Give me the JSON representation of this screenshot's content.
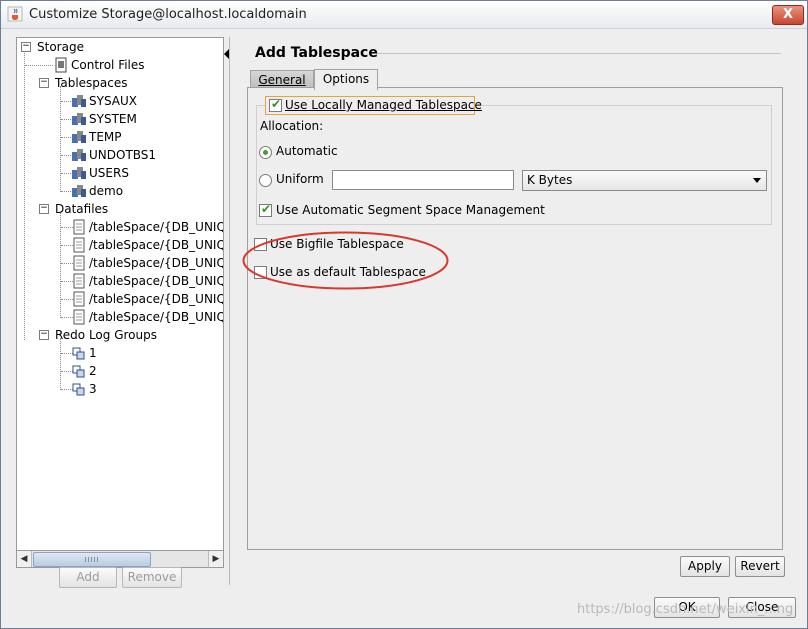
{
  "window": {
    "title": "Customize Storage@localhost.localdomain",
    "close_glyph": "X"
  },
  "tree": {
    "root": "Storage",
    "control_files": "Control Files",
    "tablespaces_label": "Tablespaces",
    "tablespaces": [
      "SYSAUX",
      "SYSTEM",
      "TEMP",
      "UNDOTBS1",
      "USERS",
      "demo"
    ],
    "datafiles_label": "Datafiles",
    "datafiles": [
      "/tableSpace/{DB_UNIQU",
      "/tableSpace/{DB_UNIQU",
      "/tableSpace/{DB_UNIQU",
      "/tableSpace/{DB_UNIQU",
      "/tableSpace/{DB_UNIQU",
      "/tableSpace/{DB_UNIQU"
    ],
    "redo_label": "Redo Log Groups",
    "redo_groups": [
      "1",
      "2",
      "3"
    ]
  },
  "tree_buttons": {
    "add": "Add",
    "remove": "Remove"
  },
  "panel": {
    "heading": "Add Tablespace",
    "tabs": [
      {
        "label": "General",
        "selected": false
      },
      {
        "label": "Options",
        "selected": true
      }
    ],
    "use_locally_managed": {
      "label": "Use Locally Managed Tablespace",
      "checked": true
    },
    "allocation_label": "Allocation:",
    "automatic": {
      "label": "Automatic",
      "selected": true
    },
    "uniform": {
      "label": "Uniform",
      "selected": false,
      "value": ""
    },
    "unit_select": {
      "value": "K Bytes"
    },
    "auto_segment": {
      "label": "Use Automatic Segment Space Management",
      "checked": true
    },
    "bigfile": {
      "label": "Use Bigfile Tablespace",
      "checked": false
    },
    "default_ts": {
      "label": "Use as default Tablespace",
      "checked": false
    }
  },
  "footer": {
    "apply": "Apply",
    "revert": "Revert",
    "ok": "OK",
    "close": "Close"
  },
  "watermark": "https://blog.csdn.net/weixin_...ng",
  "colors": {
    "check_green": "#3a8f2b",
    "annotation_red": "#d9382c",
    "selected_node": "#ffffff"
  }
}
